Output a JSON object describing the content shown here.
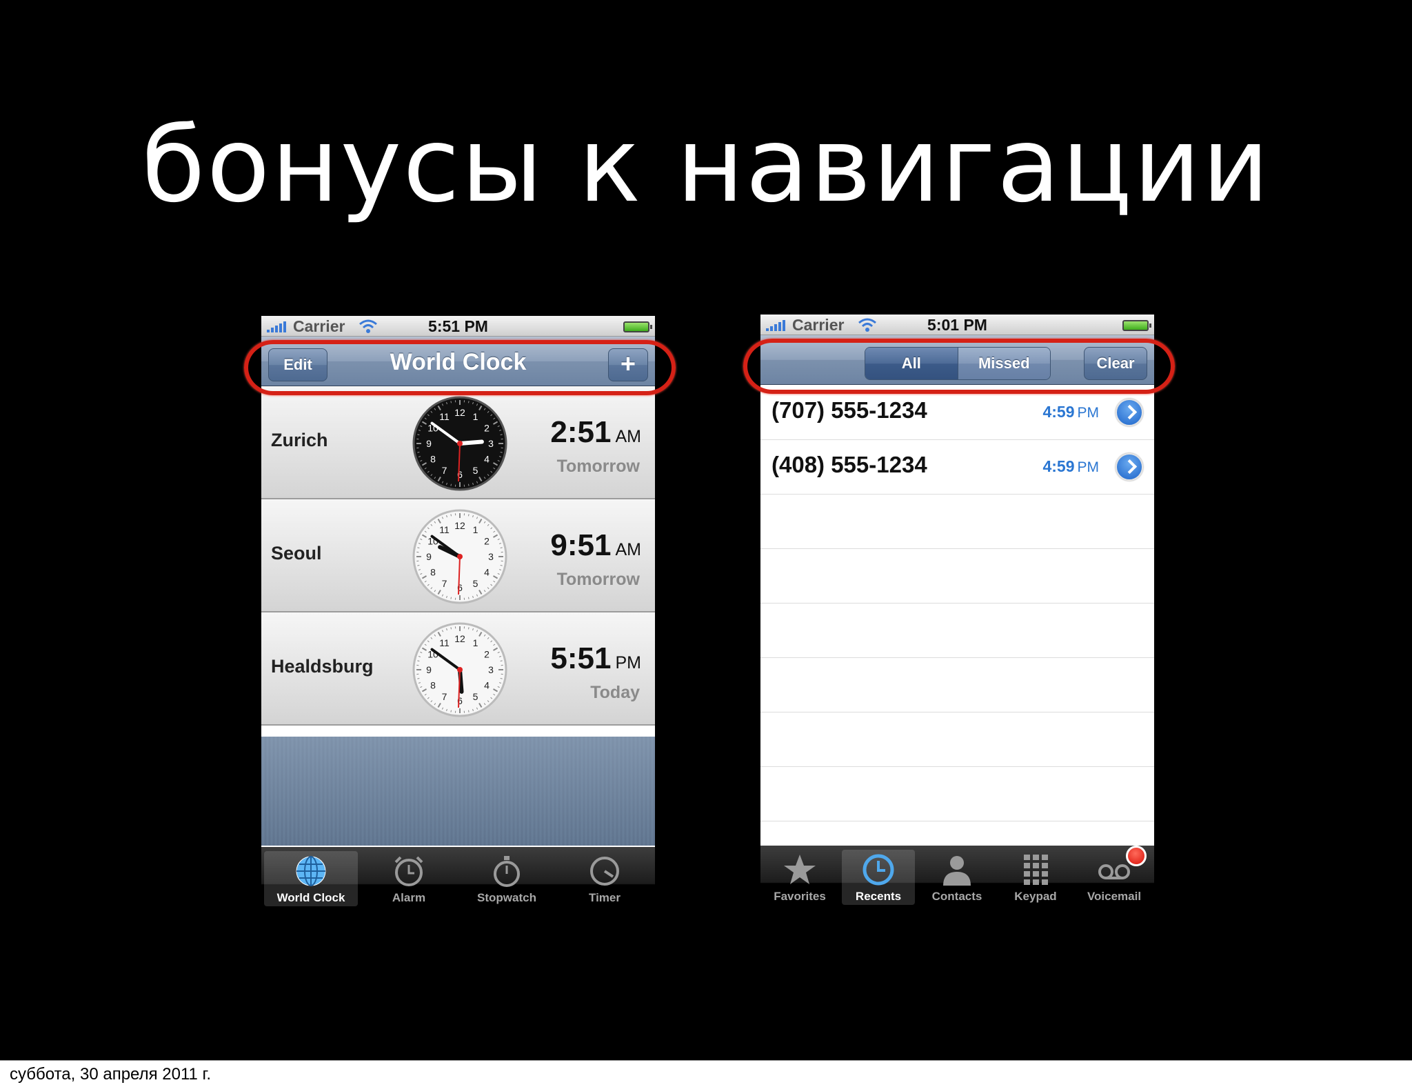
{
  "slide": {
    "title": "бонусы к навигации",
    "footer_date": "суббота, 30 апреля 2011 г."
  },
  "left_phone": {
    "status": {
      "carrier": "Carrier",
      "time": "5:51 PM"
    },
    "nav": {
      "title": "World Clock",
      "edit_label": "Edit",
      "add_label": "+"
    },
    "clocks": [
      {
        "city": "Zurich",
        "time": "2:51",
        "ampm": "AM",
        "day": "Tomorrow",
        "face": "dark",
        "hour": 2,
        "minute": 51
      },
      {
        "city": "Seoul",
        "time": "9:51",
        "ampm": "AM",
        "day": "Tomorrow",
        "face": "light",
        "hour": 9,
        "minute": 51
      },
      {
        "city": "Healdsburg",
        "time": "5:51",
        "ampm": "PM",
        "day": "Today",
        "face": "light",
        "hour": 5,
        "minute": 51
      }
    ],
    "tabs": [
      {
        "label": "World Clock",
        "icon": "globe-icon",
        "active": true
      },
      {
        "label": "Alarm",
        "icon": "alarm-clock-icon",
        "active": false
      },
      {
        "label": "Stopwatch",
        "icon": "stopwatch-icon",
        "active": false
      },
      {
        "label": "Timer",
        "icon": "timer-icon",
        "active": false
      }
    ]
  },
  "right_phone": {
    "status": {
      "carrier": "Carrier",
      "time": "5:01 PM"
    },
    "nav": {
      "segment_all": "All",
      "segment_missed": "Missed",
      "selected": "All",
      "clear_label": "Clear"
    },
    "calls": [
      {
        "number": "(707) 555-1234",
        "time": "4:59",
        "ampm": "PM"
      },
      {
        "number": "(408) 555-1234",
        "time": "4:59",
        "ampm": "PM"
      }
    ],
    "tabs": [
      {
        "label": "Favorites",
        "icon": "star-icon",
        "active": false
      },
      {
        "label": "Recents",
        "icon": "clock-icon",
        "active": true
      },
      {
        "label": "Contacts",
        "icon": "person-icon",
        "active": false
      },
      {
        "label": "Keypad",
        "icon": "keypad-icon",
        "active": false
      },
      {
        "label": "Voicemail",
        "icon": "voicemail-icon",
        "active": false,
        "badge": true
      }
    ]
  },
  "colors": {
    "background": "#000000",
    "highlight_oval": "#d52116",
    "nav_bar": "#8ea1bb",
    "link_blue": "#2a76d2"
  }
}
